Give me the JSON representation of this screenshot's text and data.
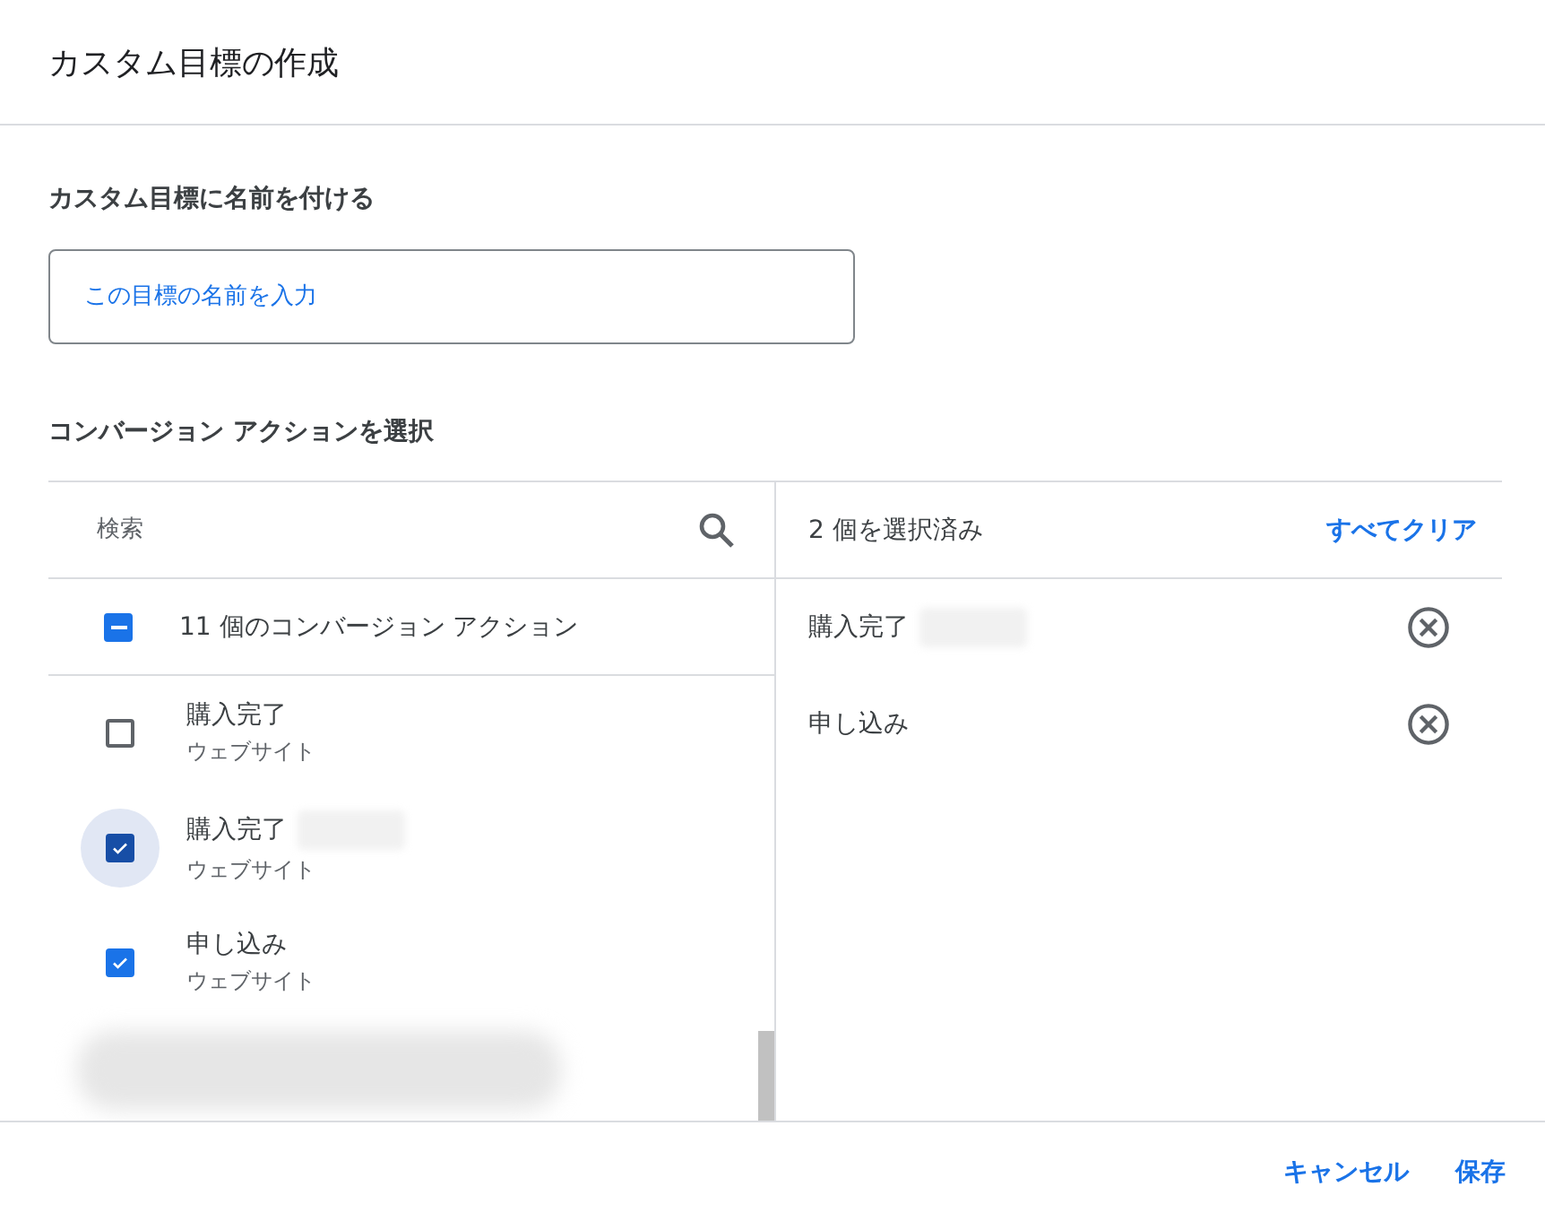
{
  "dialog": {
    "title": "カスタム目標の作成"
  },
  "name_section": {
    "heading": "カスタム目標に名前を付ける",
    "field": {
      "placeholder": "この目標の名前を入力"
    }
  },
  "action_section": {
    "heading": "コンバージョン アクションを選択",
    "search": {
      "placeholder": "検索"
    },
    "select_all": {
      "label": "11 個のコンバージョン アクション",
      "partial": true
    },
    "actions": [
      {
        "kind": "action",
        "name": "購入完了",
        "type": "ウェブサイト",
        "checked": false,
        "focused": false,
        "redacted": false
      },
      {
        "kind": "action",
        "name": "購入完了",
        "type": "ウェブサイト",
        "checked": true,
        "focused": true,
        "redacted": true
      },
      {
        "kind": "action",
        "name": "申し込み",
        "type": "ウェブサイト",
        "checked": true,
        "focused": false,
        "redacted": false
      },
      {
        "kind": "hidden"
      }
    ],
    "selected_summary": "2 個を選択済み",
    "clear_all": "すべてクリア",
    "selected": [
      {
        "name": "購入完了",
        "redacted": true
      },
      {
        "name": "申し込み",
        "redacted": false
      }
    ]
  },
  "footer": {
    "buttons": [
      "キャンセル",
      "保存"
    ]
  }
}
